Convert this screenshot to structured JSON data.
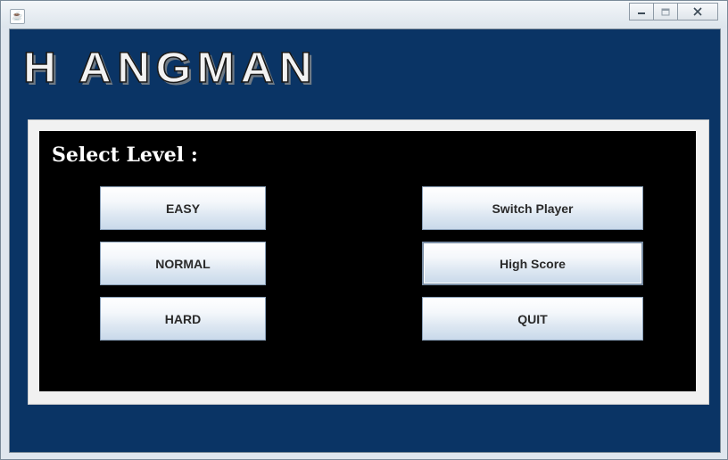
{
  "window": {
    "app_icon": "java-coffee-icon",
    "controls": [
      "minimize-icon",
      "maximize-icon",
      "close-icon"
    ]
  },
  "logo": {
    "text": "H ANGMAN"
  },
  "menu": {
    "heading": "Select Level :",
    "left_buttons": [
      "EASY",
      "NORMAL",
      "HARD"
    ],
    "right_buttons": [
      "Switch Player",
      "High Score",
      "QUIT"
    ]
  },
  "colors": {
    "frame_bg": "#0a3465",
    "panel_bg": "#000000",
    "button_text": "#2a2a2a"
  }
}
